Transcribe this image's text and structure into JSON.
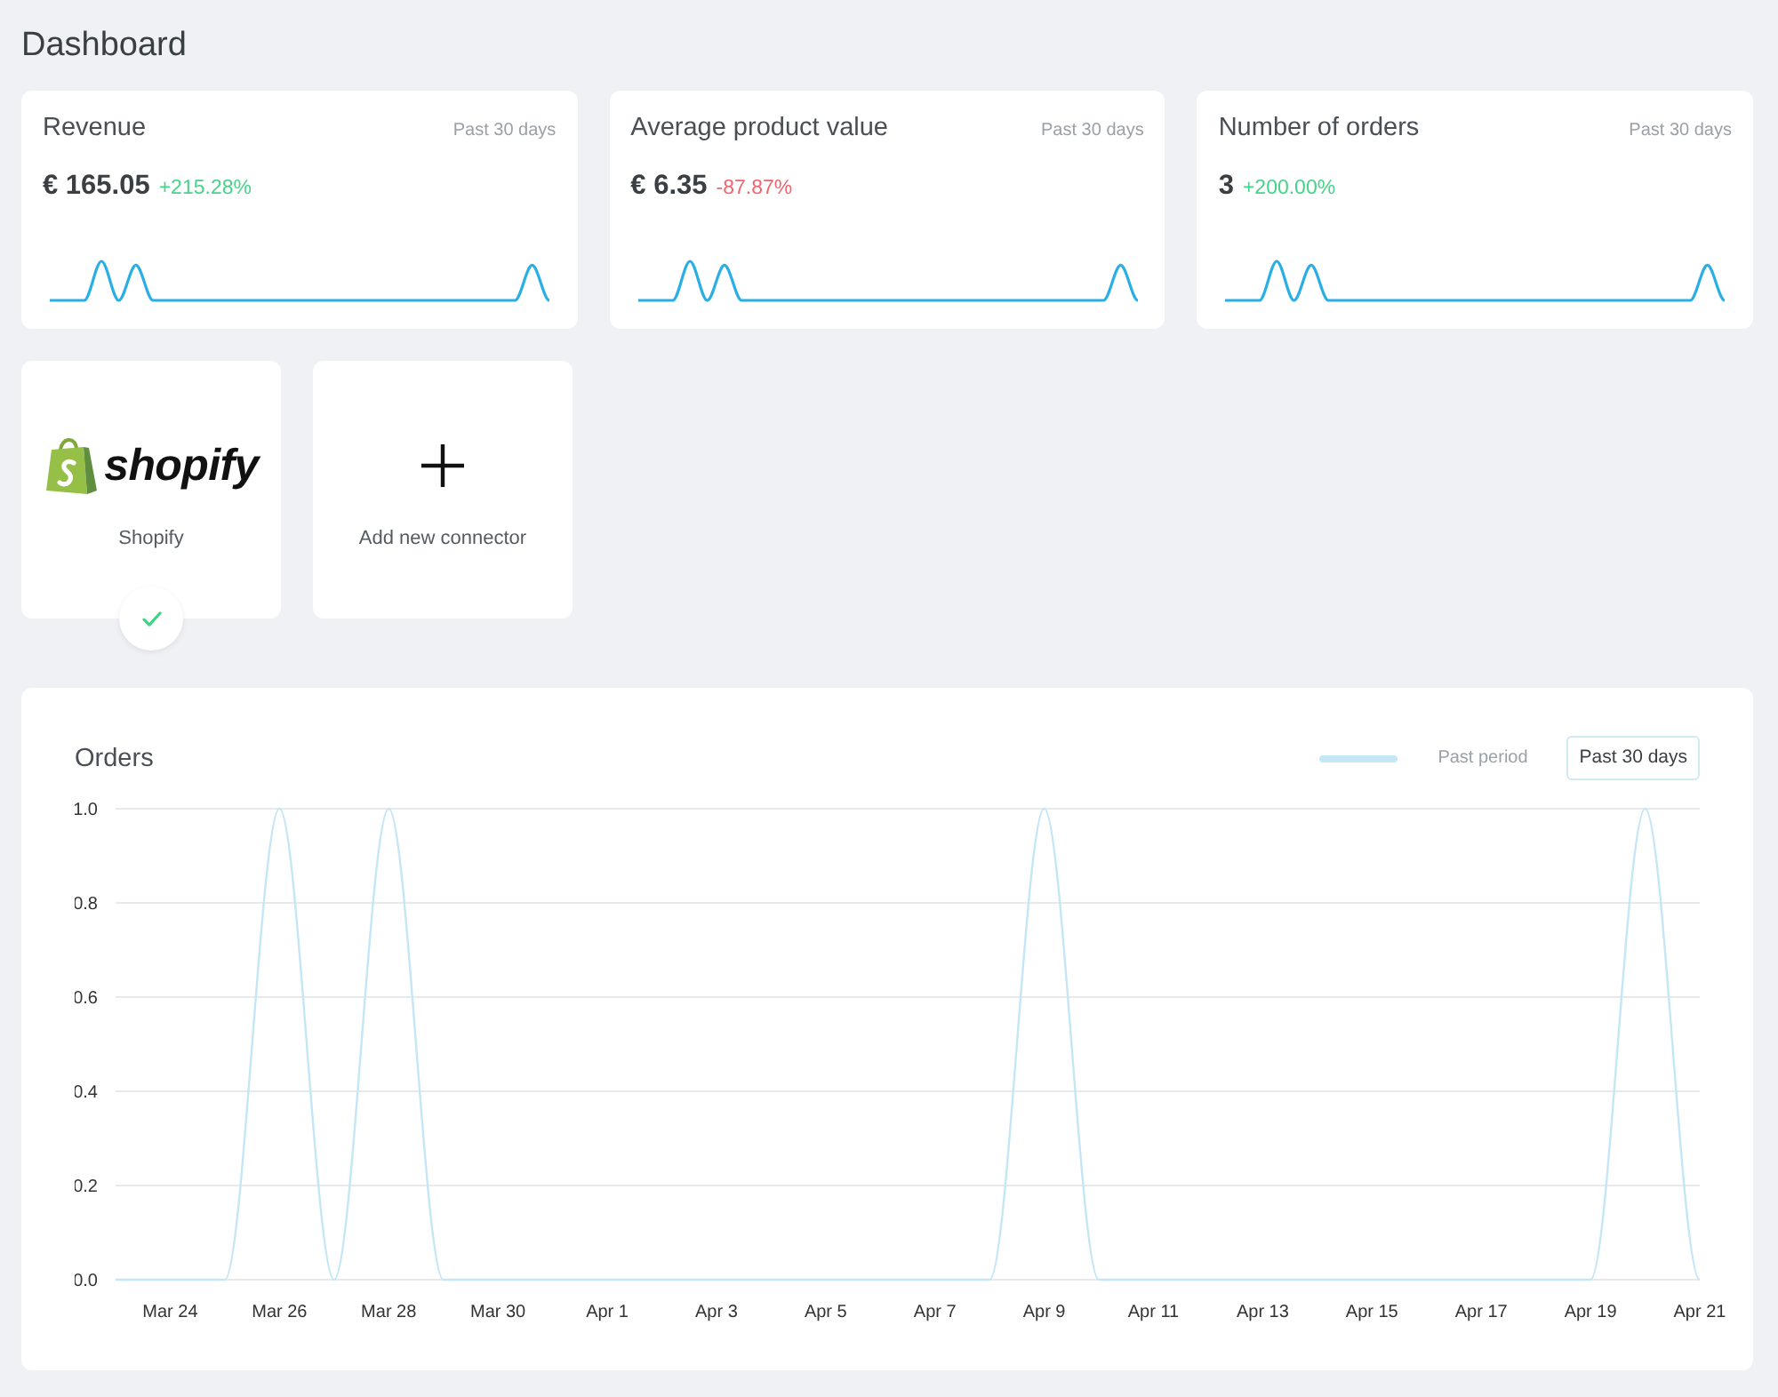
{
  "page": {
    "title": "Dashboard"
  },
  "stat_cards": [
    {
      "title": "Revenue",
      "period": "Past 30 days",
      "value": "€ 165.05",
      "change": "+215.28%",
      "positive": true
    },
    {
      "title": "Average product value",
      "period": "Past 30 days",
      "value": "€ 6.35",
      "change": "-87.87%",
      "positive": false
    },
    {
      "title": "Number of orders",
      "period": "Past 30 days",
      "value": "3",
      "change": "+200.00%",
      "positive": true
    }
  ],
  "connectors": [
    {
      "kind": "shopify",
      "logo_text": "shopify",
      "name": "Shopify",
      "connected": true
    },
    {
      "kind": "add",
      "name": "Add new connector",
      "connected": false
    }
  ],
  "orders_panel": {
    "title": "Orders",
    "period_button": "Past 30 days",
    "chart_data": {
      "type": "line",
      "grid": true,
      "categories": [
        null,
        "Mar 24",
        null,
        "Mar 26",
        null,
        "Mar 28",
        null,
        "Mar 30",
        null,
        "Apr 1",
        null,
        "Apr 3",
        null,
        "Apr 5",
        null,
        "Apr 7",
        null,
        "Apr 9",
        null,
        "Apr 11",
        null,
        "Apr 13",
        null,
        "Apr 15",
        null,
        "Apr 17",
        null,
        "Apr 19",
        null,
        "Apr 21"
      ],
      "series": [
        {
          "name": "Past period",
          "color": "#c4e6f6",
          "values": [
            0,
            0,
            0,
            1,
            0,
            1,
            0,
            0,
            0,
            0,
            0,
            0,
            0,
            0,
            0,
            0,
            0,
            1,
            0,
            0,
            0,
            0,
            0,
            0,
            0,
            0,
            0,
            0,
            1,
            0
          ]
        }
      ],
      "ylim": [
        0,
        1
      ],
      "yticks": [
        {
          "value": 0,
          "label": "0.0"
        },
        {
          "value": 0.2,
          "label": "0.2"
        },
        {
          "value": 0.4,
          "label": "0.4"
        },
        {
          "value": 0.6,
          "label": "0.6"
        },
        {
          "value": 0.8,
          "label": "0.8"
        },
        {
          "value": 1,
          "label": "1.0"
        }
      ]
    }
  }
}
